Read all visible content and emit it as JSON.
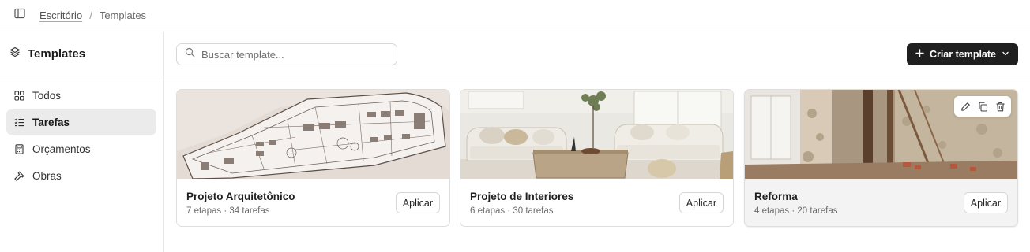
{
  "breadcrumb": {
    "parent": "Escritório",
    "current": "Templates"
  },
  "sidebar": {
    "title": "Templates",
    "items": [
      {
        "label": "Todos",
        "icon": "grid-icon",
        "active": false
      },
      {
        "label": "Tarefas",
        "icon": "checklist-icon",
        "active": true
      },
      {
        "label": "Orçamentos",
        "icon": "calculator-icon",
        "active": false
      },
      {
        "label": "Obras",
        "icon": "hammer-icon",
        "active": false
      }
    ]
  },
  "search": {
    "placeholder": "Buscar template...",
    "value": ""
  },
  "create_button": {
    "label": "Criar template"
  },
  "cards": [
    {
      "title": "Projeto Arquitetônico",
      "meta": "7 etapas · 34 tarefas",
      "apply_label": "Aplicar",
      "image": "architectural-floor-plan-sketch"
    },
    {
      "title": "Projeto de Interiores",
      "meta": "6 etapas · 30 tarefas",
      "apply_label": "Aplicar",
      "image": "living-room-interior"
    },
    {
      "title": "Reforma",
      "meta": "4 etapas · 20 tarefas",
      "apply_label": "Aplicar",
      "image": "renovation-site"
    }
  ],
  "colors": {
    "primary_button": "#1f1f1f",
    "active_nav": "#ebebeb",
    "border": "#e6e6e6"
  }
}
